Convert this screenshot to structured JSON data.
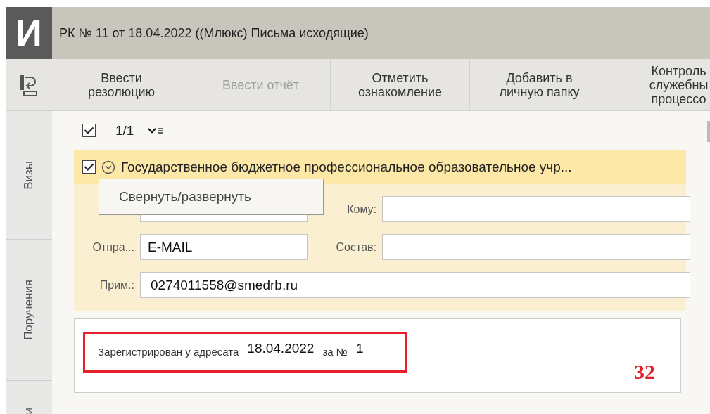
{
  "window": {
    "logo": "И",
    "title": "РК № 11 от 18.04.2022 ((Млюкс) Письма исходящие)"
  },
  "toolbar": [
    {
      "label": "Ввести\nрезолюцию",
      "disabled": false
    },
    {
      "label": "Ввести отчёт",
      "disabled": true
    },
    {
      "label": "Отметить\nознакомление",
      "disabled": false
    },
    {
      "label": "Добавить в\nличную папку",
      "disabled": false
    },
    {
      "label": "Контроль\nслужебны\nпроцессо",
      "disabled": false
    }
  ],
  "side_tabs": [
    {
      "label": "Визы",
      "selected": false
    },
    {
      "label": "Поручения",
      "selected": false
    },
    {
      "label": "и",
      "selected": false
    }
  ],
  "list_header": {
    "checked": true,
    "counter": "1/1"
  },
  "card": {
    "checked": true,
    "expanded": true,
    "title": "Государственное бюджетное профессиональное образовательное учр...",
    "context_menu": {
      "item": "Свернуть/развернуть"
    },
    "fields": {
      "kind": "form",
      "komu_label": "Кому:",
      "sender_label": "Отпра...",
      "sender_value": "E-MAIL",
      "sostav_label": "Состав:",
      "note_label": "Прим.:",
      "note_value": "0274011558@smedrb.ru"
    }
  },
  "registration": {
    "label": "Зарегистрирован у адресата",
    "date": "18.04.2022",
    "number_label": "за №",
    "number": "1",
    "highlighted": true
  },
  "annotation": "32"
}
